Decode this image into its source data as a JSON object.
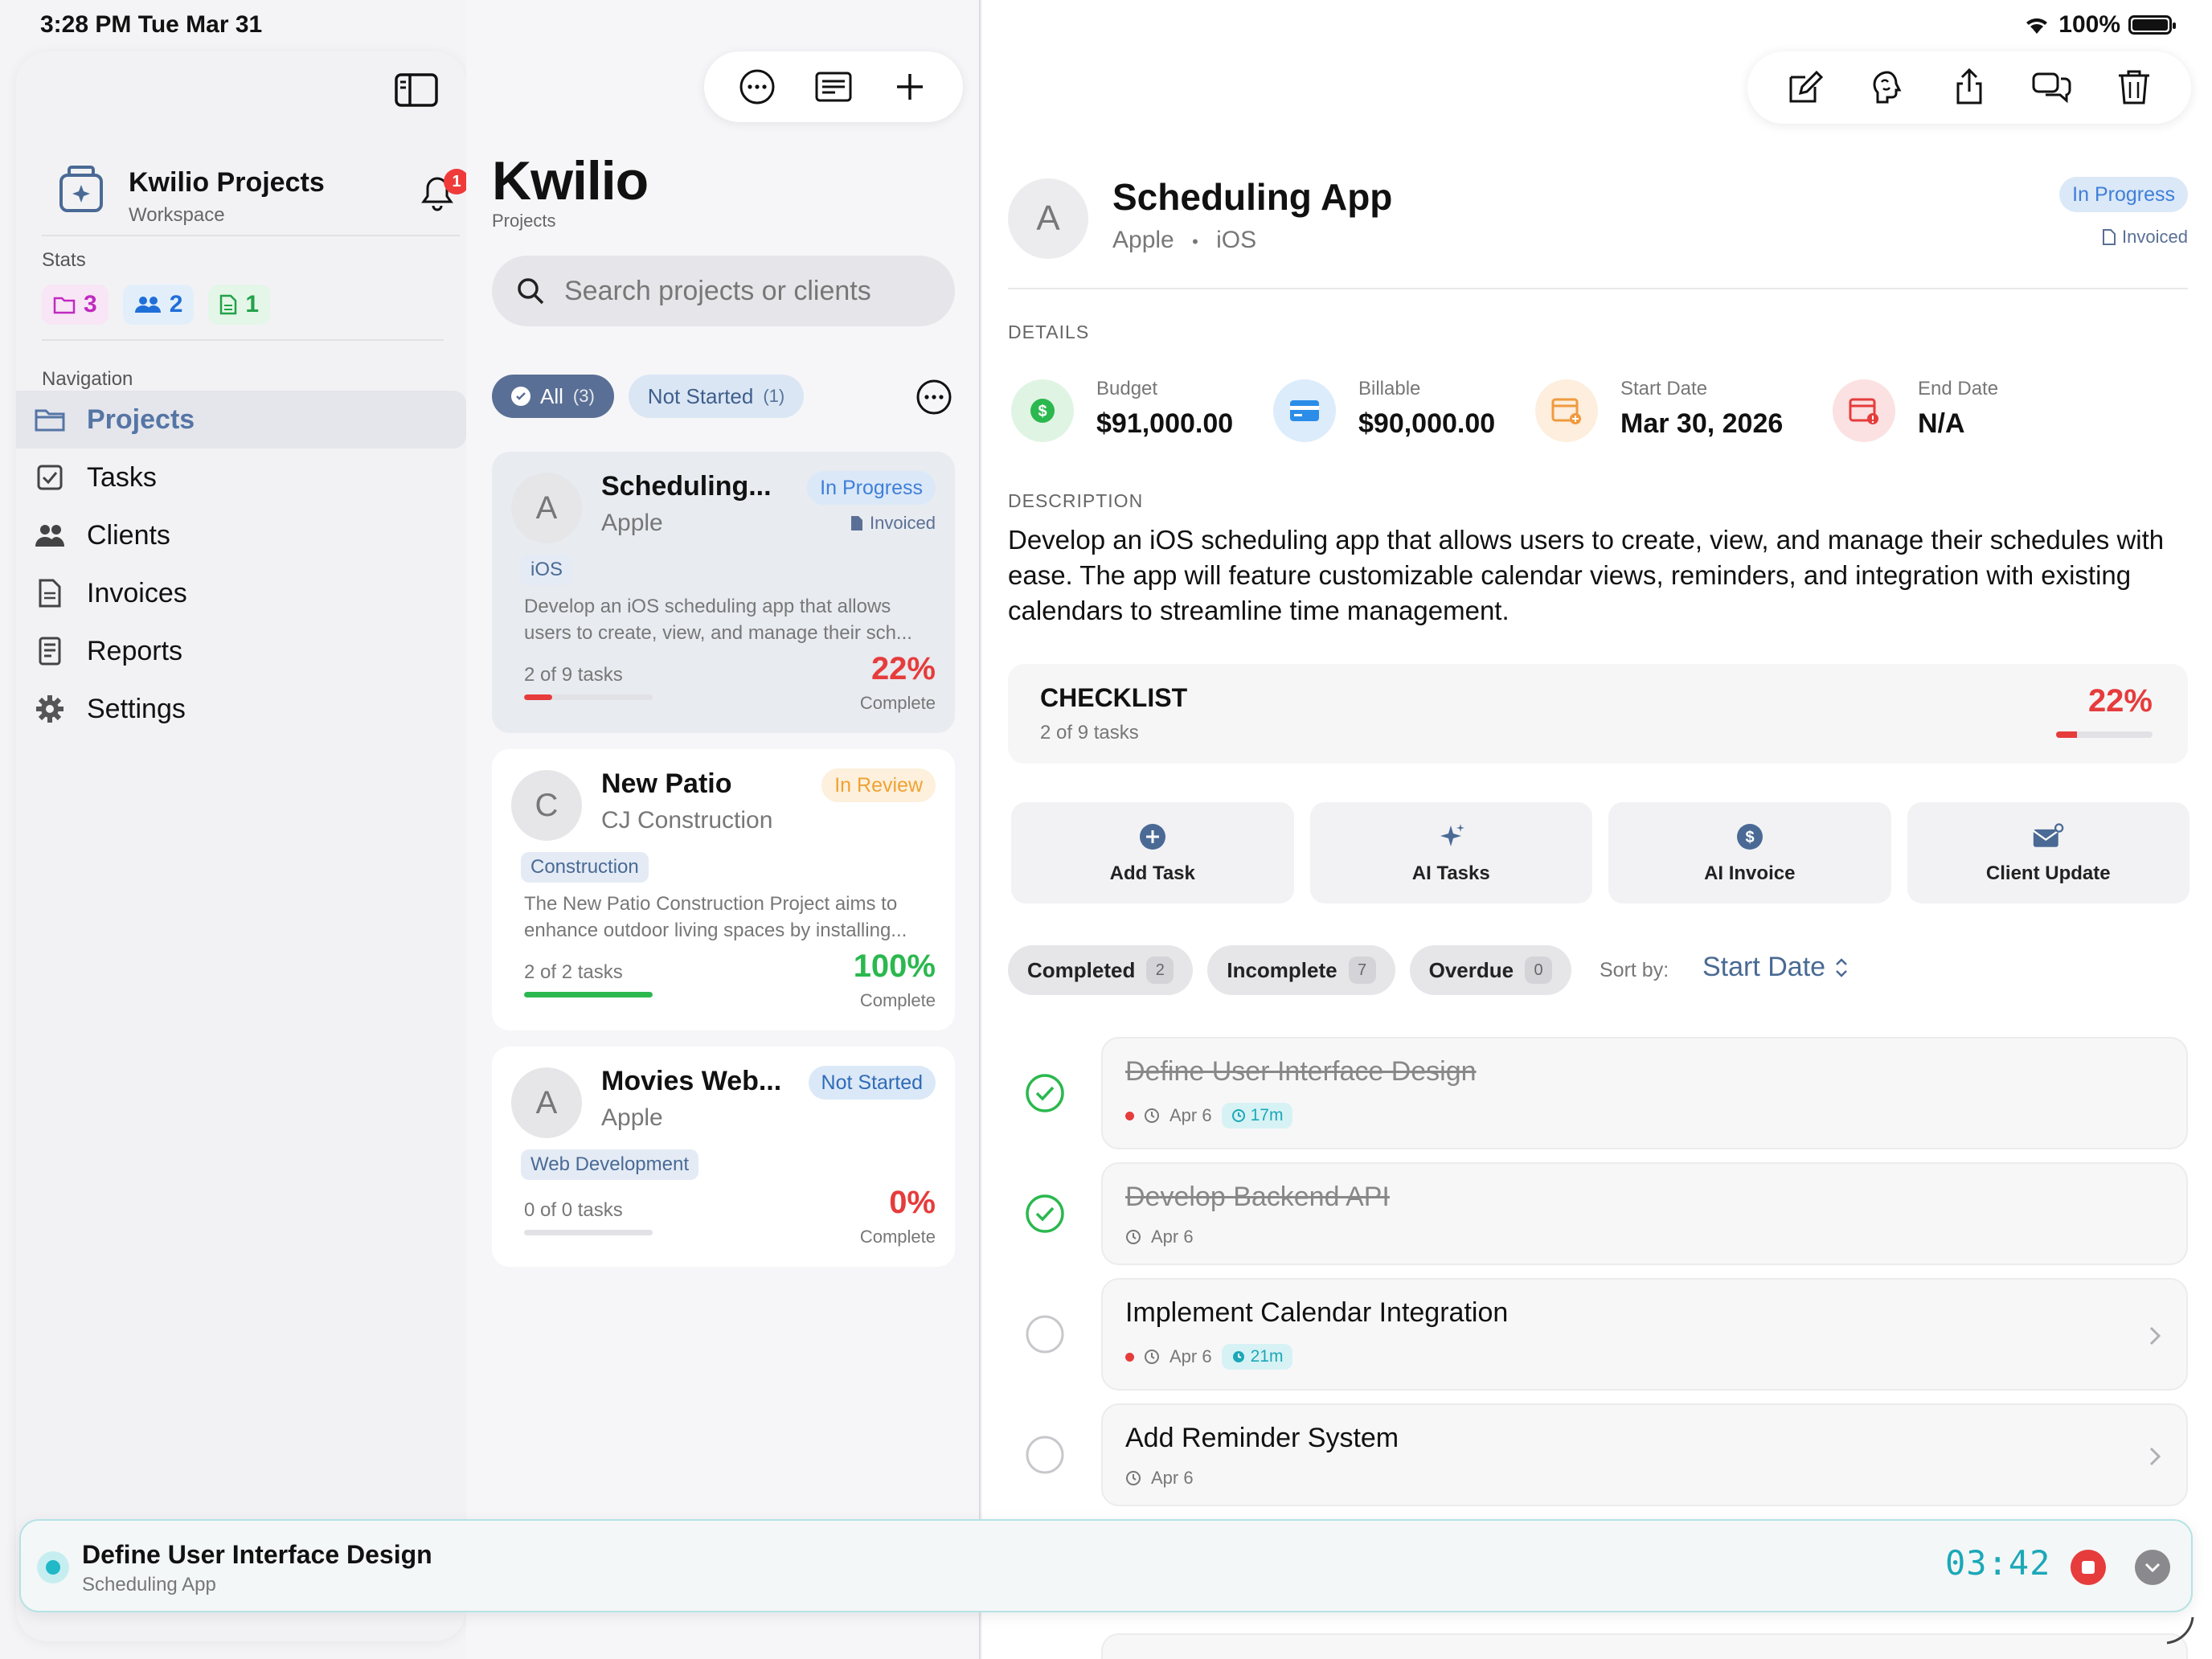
{
  "status_bar": {
    "time": "3:28 PM   Tue Mar 31",
    "battery": "100%"
  },
  "sidebar": {
    "workspace_name": "Kwilio Projects",
    "workspace_type": "Workspace",
    "notification_count": "1",
    "stats_label": "Stats",
    "stats": [
      {
        "icon": "folder-icon",
        "value": "3",
        "color": "#c02ac0"
      },
      {
        "icon": "users-icon",
        "value": "2",
        "color": "#1f6fd8"
      },
      {
        "icon": "document-icon",
        "value": "1",
        "color": "#22a24a"
      }
    ],
    "nav_label": "Navigation",
    "nav": [
      {
        "label": "Projects",
        "icon": "folder-icon",
        "active": true
      },
      {
        "label": "Tasks",
        "icon": "checkbox-icon"
      },
      {
        "label": "Clients",
        "icon": "people-icon"
      },
      {
        "label": "Invoices",
        "icon": "invoice-icon"
      },
      {
        "label": "Reports",
        "icon": "report-icon"
      },
      {
        "label": "Settings",
        "icon": "gear-icon"
      }
    ]
  },
  "projects_list": {
    "title": "Kwilio",
    "subtitle": "Projects",
    "search_placeholder": "Search projects or clients",
    "filters": [
      {
        "label": "All",
        "count": "(3)",
        "active": true
      },
      {
        "label": "Not Started",
        "count": "(1)"
      }
    ],
    "cards": [
      {
        "avatar": "A",
        "name": "Scheduling...",
        "client": "Apple",
        "status": "In Progress",
        "invoiced": "Invoiced",
        "tag": "iOS",
        "description": "Develop an iOS scheduling app that allows users to create, view, and manage their sch...",
        "tasks": "2 of 9 tasks",
        "percent": "22%",
        "progress": 0.22,
        "complete_label": "Complete",
        "color": "#e63c3c"
      },
      {
        "avatar": "C",
        "name": "New Patio",
        "client": "CJ Construction",
        "status": "In Review",
        "tag": "Construction",
        "description": "The New Patio Construction Project aims to enhance outdoor living spaces by installing...",
        "tasks": "2 of 2 tasks",
        "percent": "100%",
        "progress": 1.0,
        "complete_label": "Complete",
        "color": "#2bb84e"
      },
      {
        "avatar": "A",
        "name": "Movies Web...",
        "client": "Apple",
        "status": "Not Started",
        "tag": "Web Development",
        "tasks": "0 of 0 tasks",
        "percent": "0%",
        "progress": 0,
        "complete_label": "Complete",
        "color": "#e63c3c"
      }
    ]
  },
  "detail": {
    "avatar": "A",
    "title": "Scheduling App",
    "client": "Apple",
    "separator": "•",
    "platform": "iOS",
    "status": "In Progress",
    "invoiced": "Invoiced",
    "details_label": "DETAILS",
    "kpis": [
      {
        "label": "Budget",
        "value": "$91,000.00",
        "icon": "dollar-icon"
      },
      {
        "label": "Billable",
        "value": "$90,000.00",
        "icon": "credit-card-icon"
      },
      {
        "label": "Start Date",
        "value": "Mar 30, 2026",
        "icon": "calendar-plus-icon"
      },
      {
        "label": "End Date",
        "value": "N/A",
        "icon": "calendar-alert-icon"
      }
    ],
    "description_label": "DESCRIPTION",
    "description": "Develop an iOS scheduling app that allows users to create, view, and manage their schedules with ease. The app will feature customizable calendar views, reminders, and integration with existing calendars to streamline time management.",
    "checklist": {
      "title": "CHECKLIST",
      "subtitle": "2 of 9 tasks",
      "percent": "22%",
      "progress": 0.22
    },
    "actions": [
      {
        "label": "Add Task",
        "icon": "plus-circle-icon"
      },
      {
        "label": "AI Tasks",
        "icon": "sparkles-icon"
      },
      {
        "label": "AI Invoice",
        "icon": "dollar-circle-icon"
      },
      {
        "label": "Client Update",
        "icon": "envelope-icon"
      }
    ],
    "task_filters": [
      {
        "label": "Completed",
        "count": "2"
      },
      {
        "label": "Incomplete",
        "count": "7"
      },
      {
        "label": "Overdue",
        "count": "0"
      }
    ],
    "sort_label": "Sort by:",
    "sort_value": "Start Date",
    "tasks": [
      {
        "title": "Define User Interface Design",
        "date": "Apr 6",
        "duration": "17m",
        "done": true,
        "priority": true
      },
      {
        "title": "Develop Backend API",
        "date": "Apr 6",
        "done": true
      },
      {
        "title": "Implement Calendar Integration",
        "date": "Apr 6",
        "duration": "21m",
        "done": false,
        "priority": true
      },
      {
        "title": "Add Reminder System",
        "date": "Apr 6",
        "done": false
      }
    ]
  },
  "timer": {
    "task": "Define User Interface Design",
    "project": "Scheduling App",
    "elapsed": "03:42"
  },
  "colors": {
    "accent": "#5a6f95",
    "danger": "#e63c3c",
    "success": "#2bb84e",
    "timer": "#1ba8b8"
  }
}
